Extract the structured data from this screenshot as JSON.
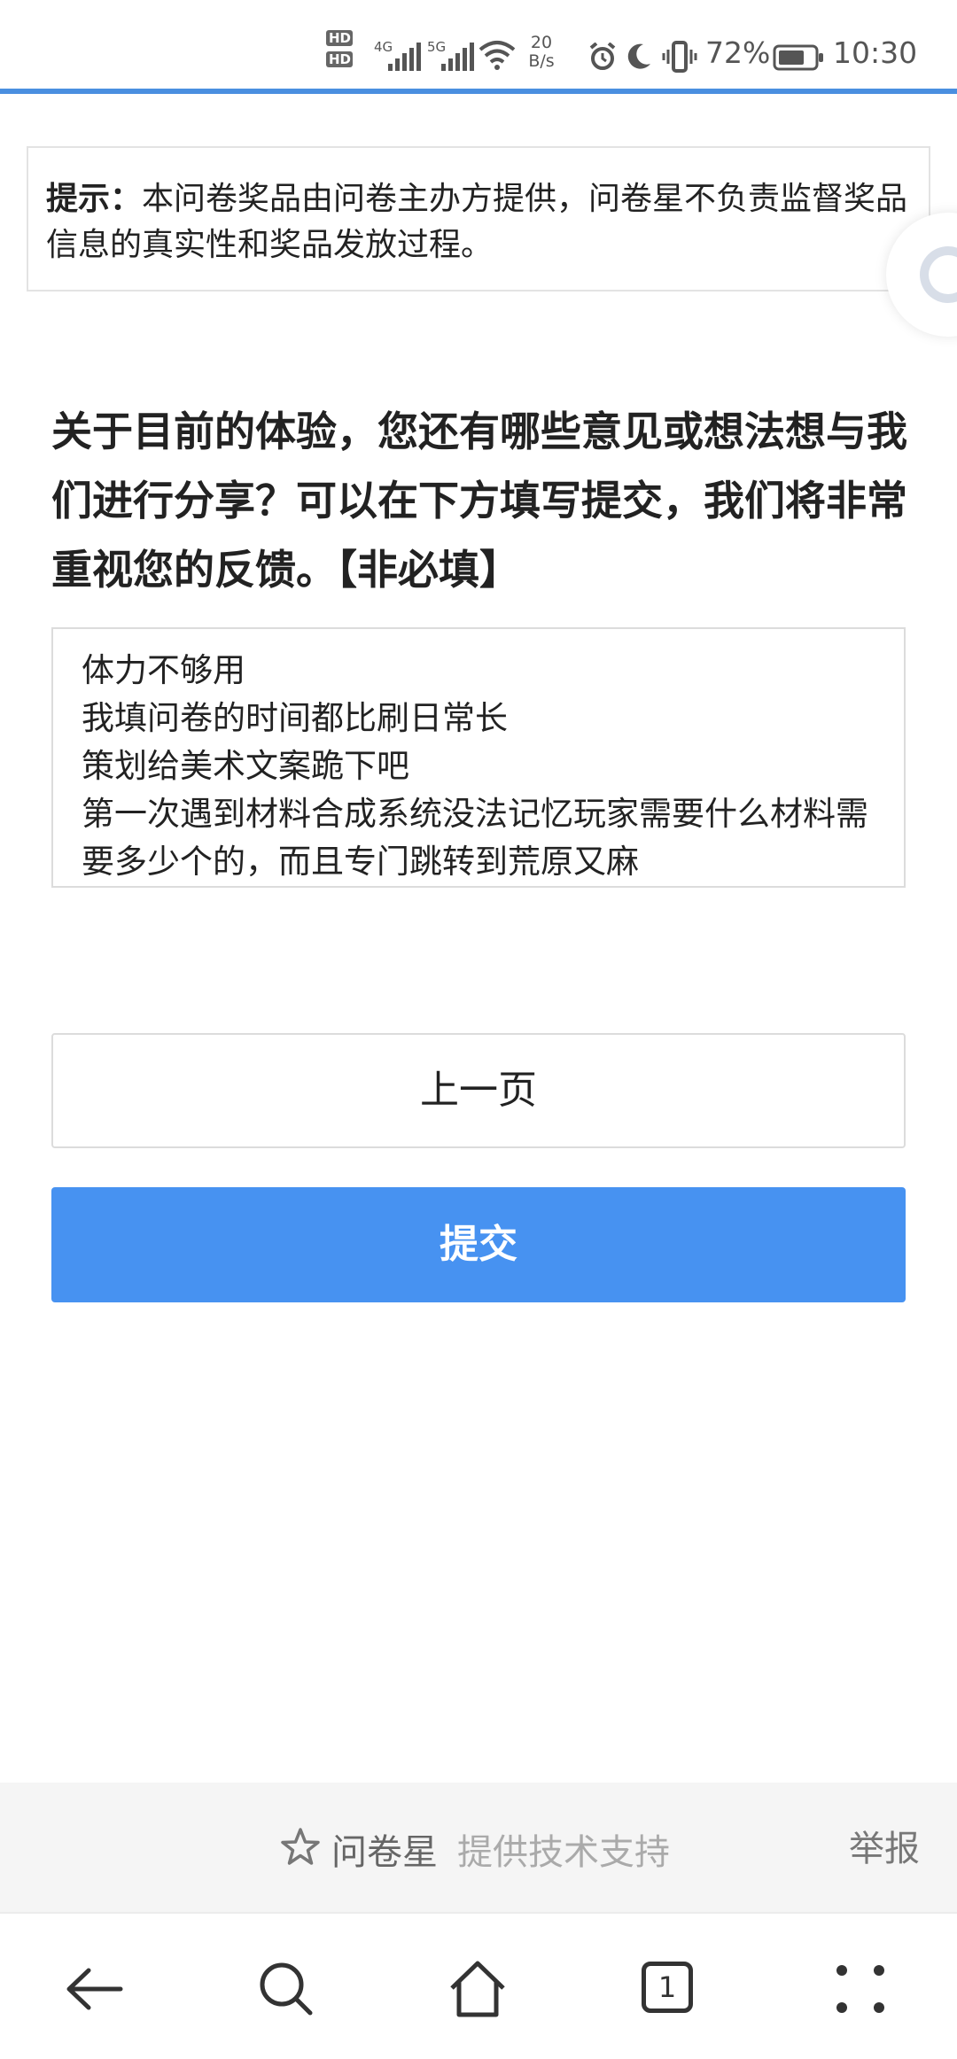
{
  "status_bar": {
    "hd1": "HD",
    "hd2": "HD",
    "sig1_tag": "4G",
    "sig2_tag": "5G",
    "speed_value": "20",
    "speed_unit": "B/s",
    "battery_pct": "72%",
    "time": "10:30",
    "icons": [
      "hd-icon",
      "signal-icon",
      "wifi-icon",
      "alarm-icon",
      "moon-icon",
      "vibrate-icon",
      "battery-icon"
    ]
  },
  "notice": {
    "label": "提示：",
    "text": "本问卷奖品由问卷主办方提供，问卷星不负责监督奖品信息的真实性和奖品发放过程。"
  },
  "question": {
    "text": "关于目前的体验，您还有哪些意见或想法想与我们进行分享？可以在下方填写提交，我们将非常重视您的反馈。【非必填】"
  },
  "answer": {
    "value": "体力不够用\n我填问卷的时间都比刷日常长\n策划给美术文案跪下吧\n第一次遇到材料合成系统没法记忆玩家需要什么材料需要多少个的，而且专门跳转到荒原又麻"
  },
  "buttons": {
    "prev": "上一页",
    "submit": "提交"
  },
  "footer": {
    "brand": "问卷星",
    "support": "提供技术支持",
    "report": "举报"
  },
  "navbar": {
    "tab_count": "1"
  },
  "colors": {
    "accent": "#4792f1",
    "status_line": "#4a8fe0",
    "footer_bg": "#f5f5f5"
  }
}
